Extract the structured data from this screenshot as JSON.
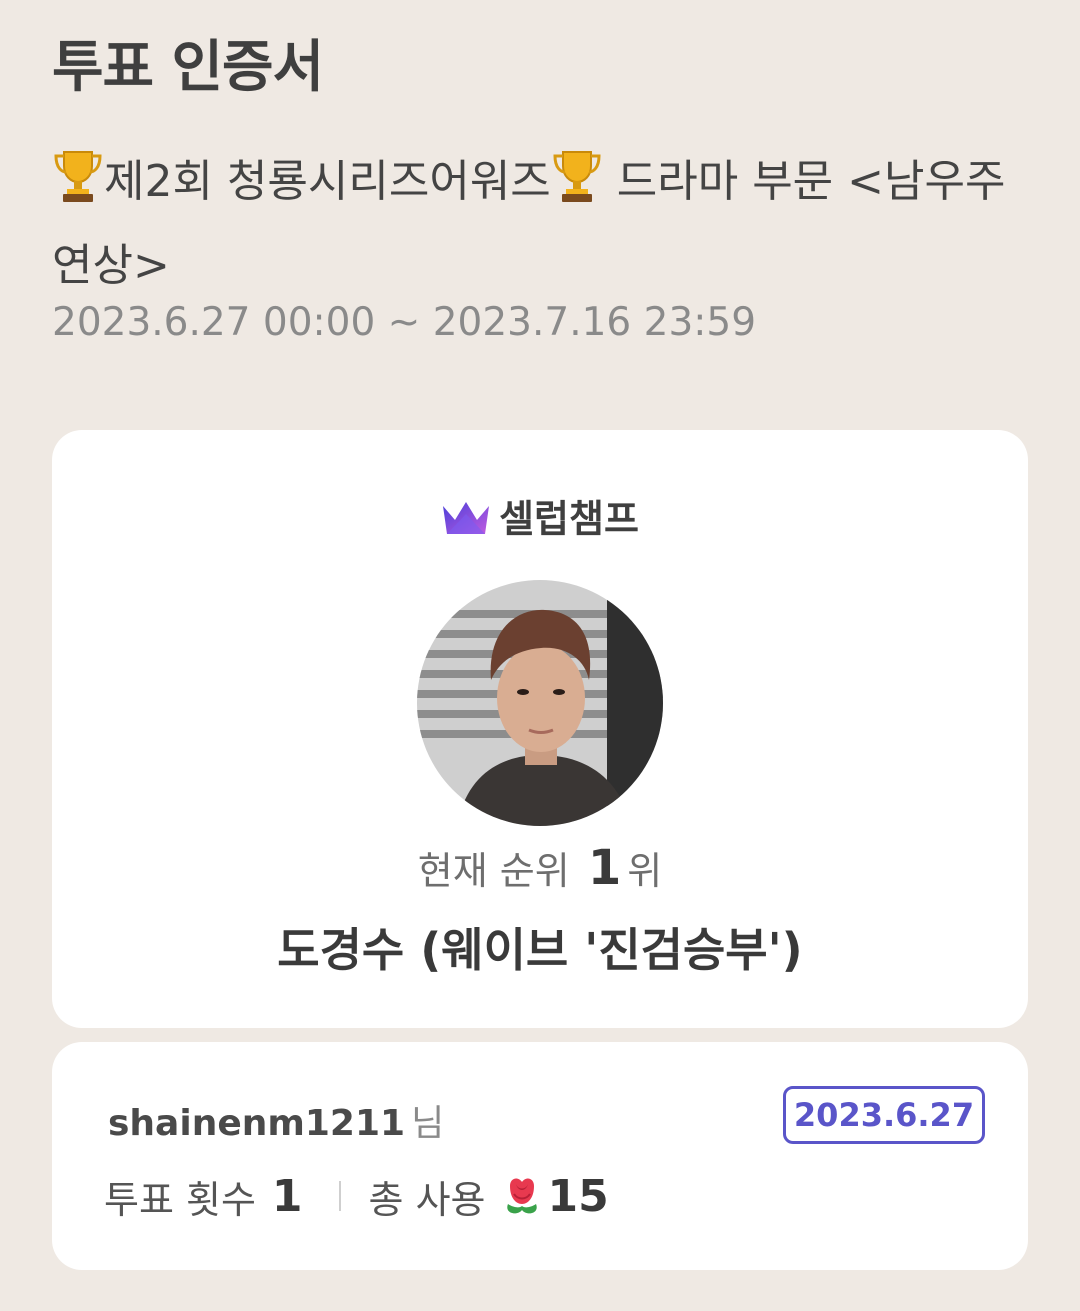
{
  "header": {
    "title": "투표 인증서"
  },
  "event": {
    "title": "제2회 청룡시리즈어워즈 드라마 부문 <남우주연상>",
    "title_part1": "제2회 청룡시리즈어워즈",
    "title_part2": " 드라마 부문 <남우주연상>",
    "period": "2023.6.27 00:00 ~ 2023.7.16 23:59",
    "icon": "trophy-icon"
  },
  "certificate": {
    "brand": "셀럽챔프",
    "brand_icon": "crown-icon",
    "avatar_icon": "profile-photo",
    "rank_label": "현재 순위",
    "rank_value": "1",
    "rank_suffix": "위",
    "nominee": "도경수 (웨이브 '진검승부')"
  },
  "voter": {
    "username": "shainenm1211",
    "honorific": "님",
    "date": "2023.6.27",
    "vote_count_label": "투표 횟수",
    "vote_count": "1",
    "total_used_label": "총 사용",
    "total_used_icon": "flower-icon",
    "total_used": "15"
  },
  "colors": {
    "background": "#efe9e3",
    "card": "#ffffff",
    "accent": "#5a55c9",
    "text": "#3d3d3d"
  }
}
